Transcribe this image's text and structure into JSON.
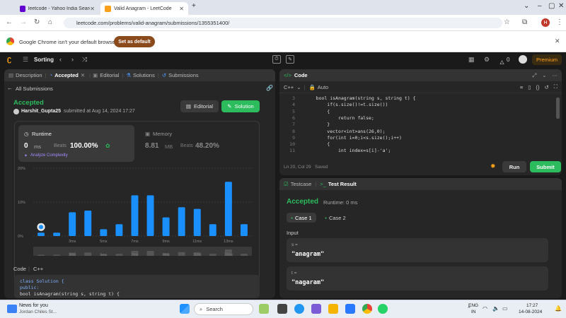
{
  "browser": {
    "tabs": [
      {
        "title": "leetcode - Yahoo India Search R"
      },
      {
        "title": "Valid Anagram - LeetCode"
      }
    ],
    "url": "leetcode.com/problems/valid-anagram/submissions/1355351400/",
    "info_message": "Google Chrome isn't your default browser",
    "info_button": "Set as default"
  },
  "lc_header": {
    "problem_list": "Sorting",
    "streak": "0",
    "premium": "Premium"
  },
  "left_tabs": {
    "description": "Description",
    "accepted": "Accepted",
    "editorial": "Editorial",
    "solutions": "Solutions",
    "submissions": "Submissions"
  },
  "submission": {
    "back": "All Submissions",
    "status": "Accepted",
    "user": "Harshit_Gupta25",
    "submitted_at": "submitted at Aug 14, 2024 17:27",
    "editorial_btn": "Editorial",
    "solution_btn": "Solution",
    "runtime_label": "Runtime",
    "runtime_value": "0",
    "runtime_unit": "ms",
    "beats_label": "Beats",
    "runtime_beats": "100.00%",
    "analyze": "Analyze Complexity",
    "memory_label": "Memory",
    "memory_value": "8.81",
    "memory_unit": "MB",
    "memory_beats": "48.20%"
  },
  "chart_data": {
    "type": "bar",
    "y_ticks": [
      "20%",
      "10%",
      "0%"
    ],
    "x_ticks": [
      "3ms",
      "5ms",
      "7ms",
      "9ms",
      "11ms",
      "13ms"
    ],
    "values": [
      1,
      1,
      7,
      7.5,
      2,
      3.5,
      12,
      12,
      5.5,
      8.5,
      8,
      3.5,
      16,
      3.5
    ],
    "highlight_index": 0,
    "ylim": [
      0,
      20
    ],
    "accent": "#1a90ff"
  },
  "code_section": {
    "label": "Code",
    "lang": "C++",
    "lines": [
      "class Solution {",
      "public:",
      "    bool isAnagram(string s, string t) {"
    ]
  },
  "editor": {
    "title": "Code",
    "lang": "C++",
    "mode": "Auto",
    "start_line": 3,
    "lines": [
      "    bool isAnagram(string s, string t) {",
      "        if(s.size()!=t.size())",
      "        {",
      "            return false;",
      "        }",
      "        vector<int>ans(26,0);",
      "        for(int i=0;i<s.size();i++)",
      "        {",
      "            int index=s[i]-'a';"
    ],
    "status": "Ln 20, Col 29",
    "saved": "Saved",
    "run": "Run",
    "submit": "Submit"
  },
  "result": {
    "testcase_tab": "Testcase",
    "result_tab": "Test Result",
    "status": "Accepted",
    "runtime": "Runtime: 0 ms",
    "cases": [
      "Case 1",
      "Case 2"
    ],
    "input_label": "Input",
    "inputs": [
      {
        "name": "s =",
        "value": "\"anagram\""
      },
      {
        "name": "t =",
        "value": "\"nagaram\""
      }
    ]
  },
  "taskbar": {
    "news": "News for you",
    "news_sub": "Jordan Chiles St...",
    "search": "Search",
    "lang1": "ENG",
    "lang2": "IN",
    "time": "17:27",
    "date": "14-08-2024"
  }
}
